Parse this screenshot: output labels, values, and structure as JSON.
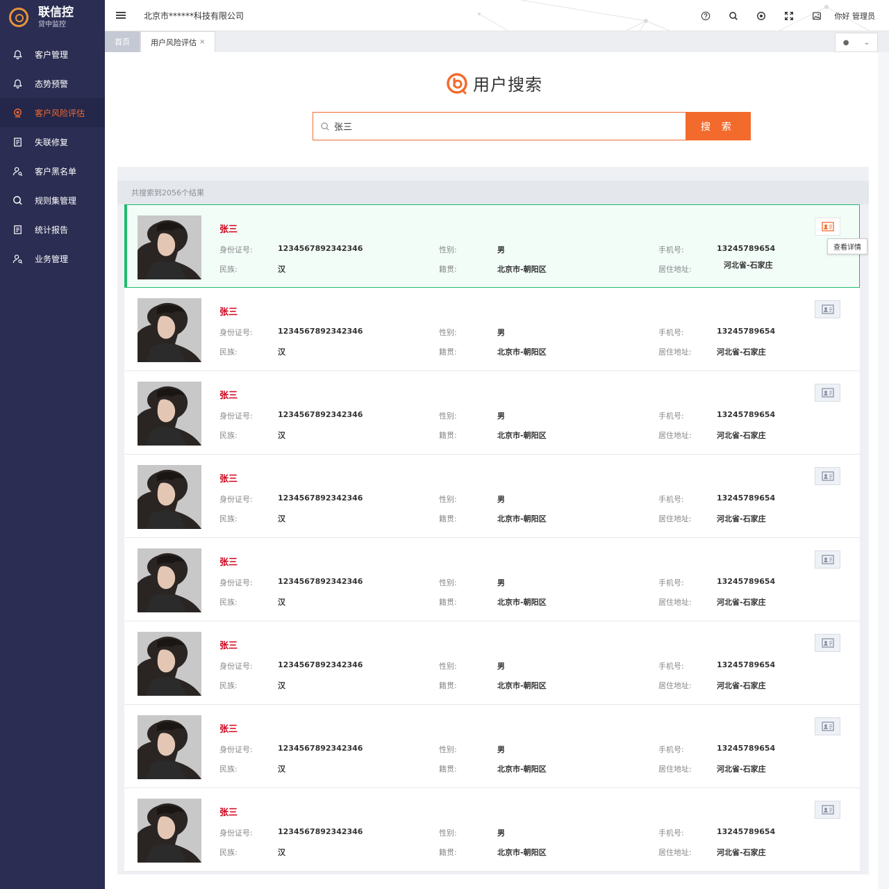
{
  "brand": {
    "name": "联信控",
    "subtitle": "贷中监控"
  },
  "sidebar": {
    "items": [
      {
        "label": "客户管理",
        "icon": "bell-icon",
        "active": false
      },
      {
        "label": "态势预警",
        "icon": "bell-icon",
        "active": false
      },
      {
        "label": "客户风险评估",
        "icon": "camera-icon",
        "active": true
      },
      {
        "label": "失联修复",
        "icon": "document-icon",
        "active": false
      },
      {
        "label": "客户黑名单",
        "icon": "user-icon",
        "active": false
      },
      {
        "label": "规则集管理",
        "icon": "search-icon",
        "active": false
      },
      {
        "label": "统计报告",
        "icon": "document-icon",
        "active": false
      },
      {
        "label": "业务管理",
        "icon": "user-icon",
        "active": false
      }
    ]
  },
  "header": {
    "company": "北京市******科技有限公司",
    "greeting": "你好 管理员",
    "tools": [
      "help-icon",
      "search-icon",
      "target-icon",
      "fullscreen-icon",
      "image-icon"
    ]
  },
  "tabs": [
    {
      "label": "首页",
      "active": false,
      "closable": false
    },
    {
      "label": "用户风险评估",
      "active": true,
      "closable": true,
      "close": "×"
    }
  ],
  "search": {
    "title": "用户搜索",
    "value": "张三",
    "button": "搜 索"
  },
  "results": {
    "summary": "共搜索到2056个结果",
    "labels": {
      "id": "身份证号:",
      "ethnicity": "民族:",
      "gender": "性别:",
      "origin": "籍贯:",
      "phone": "手机号:",
      "address": "居住地址:"
    },
    "tooltip": "查看详情",
    "items": [
      {
        "name": "张三",
        "id": "1234567892342346",
        "ethnicity": "汉",
        "gender": "男",
        "origin": "北京市-朝阳区",
        "phone": "13245789654",
        "address": "河北省-石家庄",
        "highlight": true
      },
      {
        "name": "张三",
        "id": "1234567892342346",
        "ethnicity": "汉",
        "gender": "男",
        "origin": "北京市-朝阳区",
        "phone": "13245789654",
        "address": "河北省-石家庄",
        "highlight": false
      },
      {
        "name": "张三",
        "id": "1234567892342346",
        "ethnicity": "汉",
        "gender": "男",
        "origin": "北京市-朝阳区",
        "phone": "13245789654",
        "address": "河北省-石家庄",
        "highlight": false
      },
      {
        "name": "张三",
        "id": "1234567892342346",
        "ethnicity": "汉",
        "gender": "男",
        "origin": "北京市-朝阳区",
        "phone": "13245789654",
        "address": "河北省-石家庄",
        "highlight": false
      },
      {
        "name": "张三",
        "id": "1234567892342346",
        "ethnicity": "汉",
        "gender": "男",
        "origin": "北京市-朝阳区",
        "phone": "13245789654",
        "address": "河北省-石家庄",
        "highlight": false
      },
      {
        "name": "张三",
        "id": "1234567892342346",
        "ethnicity": "汉",
        "gender": "男",
        "origin": "北京市-朝阳区",
        "phone": "13245789654",
        "address": "河北省-石家庄",
        "highlight": false
      },
      {
        "name": "张三",
        "id": "1234567892342346",
        "ethnicity": "汉",
        "gender": "男",
        "origin": "北京市-朝阳区",
        "phone": "13245789654",
        "address": "河北省-石家庄",
        "highlight": false
      },
      {
        "name": "张三",
        "id": "1234567892342346",
        "ethnicity": "汉",
        "gender": "男",
        "origin": "北京市-朝阳区",
        "phone": "13245789654",
        "address": "河北省-石家庄",
        "highlight": false
      }
    ]
  },
  "colors": {
    "sidebar_bg": "#2b2d52",
    "accent": "#f26b2c",
    "highlight_border": "#1fbb6f",
    "name_red": "#d0021b"
  }
}
